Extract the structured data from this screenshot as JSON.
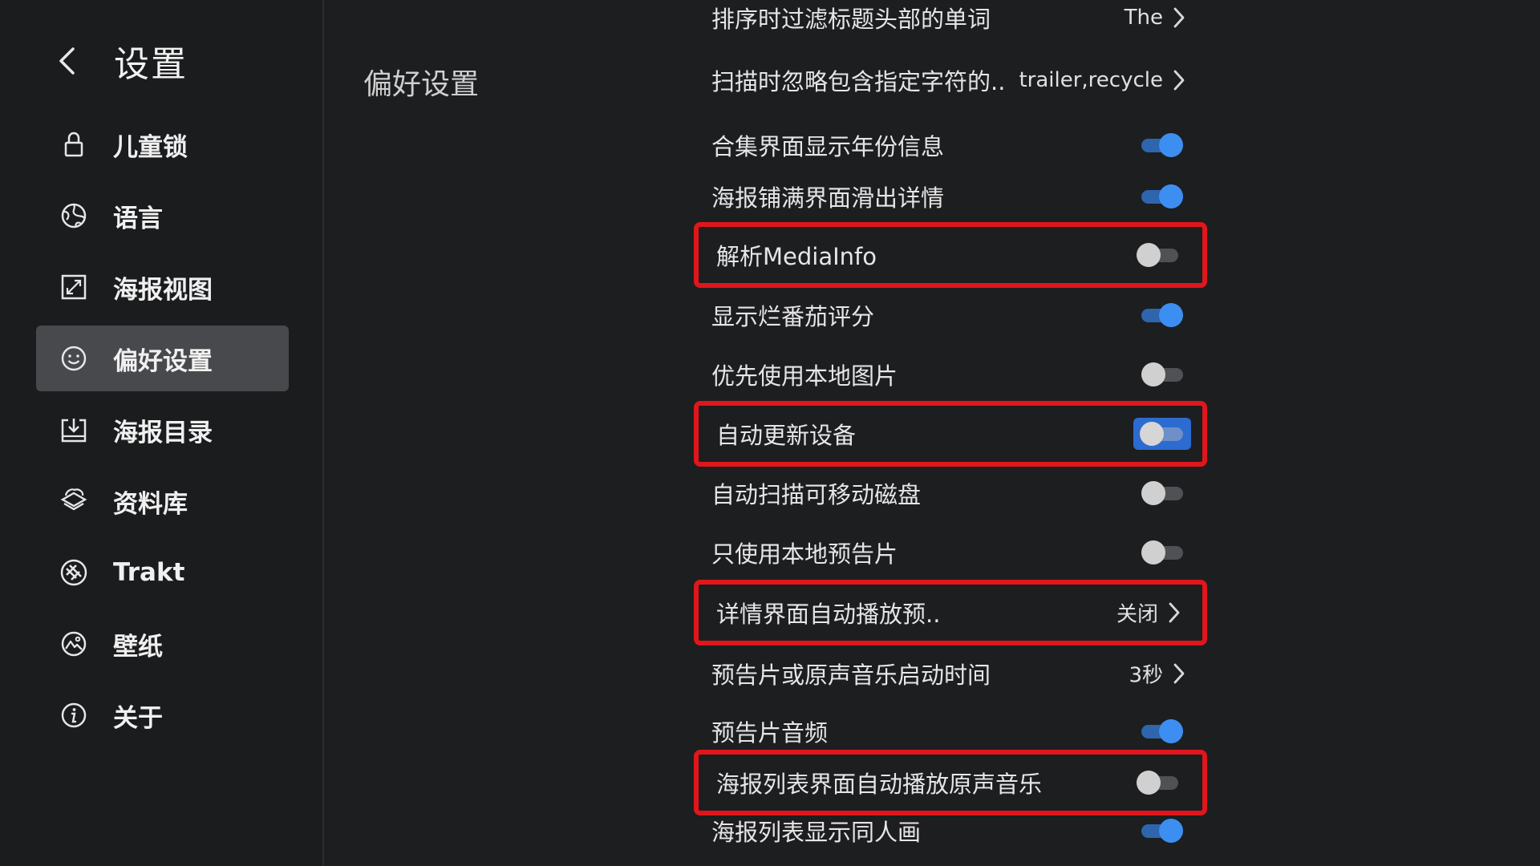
{
  "sidebar": {
    "title": "设置",
    "items": [
      {
        "label": "儿童锁",
        "icon": "lock-icon"
      },
      {
        "label": "语言",
        "icon": "globe-icon"
      },
      {
        "label": "海报视图",
        "icon": "expand-icon"
      },
      {
        "label": "偏好设置",
        "icon": "smiley-icon",
        "active": true
      },
      {
        "label": "海报目录",
        "icon": "download-box-icon"
      },
      {
        "label": "资料库",
        "icon": "layers-icon"
      },
      {
        "label": "Trakt",
        "icon": "trakt-icon"
      },
      {
        "label": "壁纸",
        "icon": "picture-icon"
      },
      {
        "label": "关于",
        "icon": "info-icon"
      }
    ]
  },
  "main": {
    "section_title": "偏好设置",
    "rows": [
      {
        "label": "排序时过滤标题头部的单词",
        "type": "link",
        "value": "The"
      },
      {
        "label": "扫描时忽略包含指定字符的..",
        "type": "link",
        "value": "trailer,recycle"
      },
      {
        "label": "合集界面显示年份信息",
        "type": "toggle",
        "on": true
      },
      {
        "label": "海报铺满界面滑出详情",
        "type": "toggle",
        "on": true
      },
      {
        "label": "解析MediaInfo",
        "type": "toggle",
        "on": false,
        "highlighted": true
      },
      {
        "label": "显示烂番茄评分",
        "type": "toggle",
        "on": true
      },
      {
        "label": "优先使用本地图片",
        "type": "toggle",
        "on": false
      },
      {
        "label": "自动更新设备",
        "type": "toggle",
        "on": false,
        "highlighted": true,
        "focused": true
      },
      {
        "label": "自动扫描可移动磁盘",
        "type": "toggle",
        "on": false
      },
      {
        "label": "只使用本地预告片",
        "type": "toggle",
        "on": false
      },
      {
        "label": "详情界面自动播放预..",
        "type": "link",
        "value": "关闭",
        "highlighted": true
      },
      {
        "label": "预告片或原声音乐启动时间",
        "type": "link",
        "value": "3秒"
      },
      {
        "label": "预告片音频",
        "type": "toggle",
        "on": true
      },
      {
        "label": "海报列表界面自动播放原声音乐",
        "type": "toggle",
        "on": false,
        "highlighted": true
      },
      {
        "label": "海报列表显示同人画",
        "type": "toggle",
        "on": true
      }
    ]
  },
  "colors": {
    "background": "#1d1e20",
    "active_nav": "#48494c",
    "toggle_on": "#3d8ef1",
    "highlight_border": "#e0161b"
  }
}
